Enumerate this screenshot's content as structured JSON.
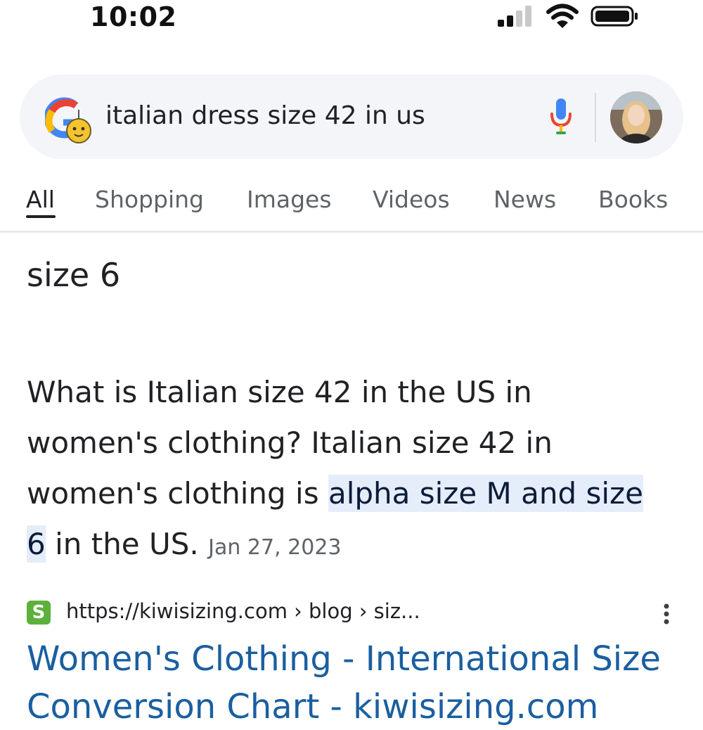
{
  "status_bar": {
    "time": "10:02"
  },
  "search": {
    "query": "italian dress size 42 in us"
  },
  "tabs": [
    {
      "label": "All",
      "active": true
    },
    {
      "label": "Shopping",
      "active": false
    },
    {
      "label": "Images",
      "active": false
    },
    {
      "label": "Videos",
      "active": false
    },
    {
      "label": "News",
      "active": false
    },
    {
      "label": "Books",
      "active": false
    }
  ],
  "answer": {
    "title": "size 6",
    "text_before": "What is Italian size 42 in the US in women's clothing? Italian size 42 in women's clothing is ",
    "highlight": "alpha size M and size 6",
    "text_after": " in the US.",
    "date": "Jan 27, 2023"
  },
  "result": {
    "favicon_letter": "S",
    "url": "https://kiwisizing.com › blog › siz...",
    "title_line1": "Women's Clothing - International Size",
    "title_line2": "Conversion Chart - kiwisizing.com"
  },
  "icons": {
    "signal": "cellular-signal-icon",
    "wifi": "wifi-icon",
    "battery": "battery-icon",
    "google_logo": "google-doodle-logo",
    "mic": "microphone-icon",
    "more": "more-vert-icon"
  },
  "colors": {
    "link": "#1a5fa0",
    "highlight": "#e5edfb",
    "favicon": "#5cb03b",
    "search_bg": "#f3f5f8"
  }
}
